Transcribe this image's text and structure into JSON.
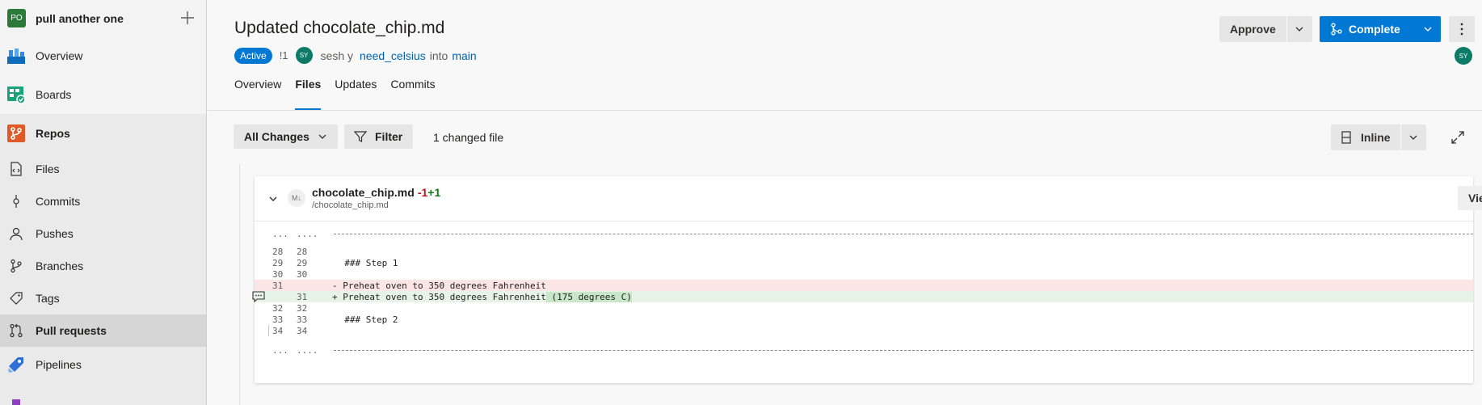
{
  "project": {
    "avatar": "PO",
    "name": "pull another one"
  },
  "nav": {
    "overview": "Overview",
    "boards": "Boards",
    "repos": "Repos",
    "files": "Files",
    "commits": "Commits",
    "pushes": "Pushes",
    "branches": "Branches",
    "tags": "Tags",
    "pull_requests": "Pull requests",
    "pipelines": "Pipelines"
  },
  "pr": {
    "title": "Updated chocolate_chip.md",
    "status": "Active",
    "id": "!1",
    "author_avatar": "SY",
    "author": "sesh y",
    "source_branch": "need_celsius",
    "into": "into",
    "target_branch": "main",
    "approve_label": "Approve",
    "complete_label": "Complete",
    "reviewer_avatar": "SY"
  },
  "tabs": [
    "Overview",
    "Files",
    "Updates",
    "Commits"
  ],
  "toolbar": {
    "all_changes": "All Changes",
    "filter": "Filter",
    "changed_files": "1 changed file",
    "view_mode": "Inline"
  },
  "file": {
    "icon": "M↓",
    "name": "chocolate_chip.md",
    "deletions": "-1",
    "additions": "+1",
    "path": "/chocolate_chip.md",
    "view_label": "View"
  },
  "diff_lines": {
    "sep_top_a": "...",
    "sep_top_b": "....",
    "l28a": "28",
    "l28b": "28",
    "c28": "",
    "l29a": "29",
    "l29b": "29",
    "c29": "  ### Step 1",
    "l30a": "30",
    "l30b": "30",
    "c30": "",
    "l31a": "31",
    "c31": "- Preheat oven to 350 degrees Fahrenheit",
    "l31b": "31",
    "c31add": "+ Preheat oven to 350 degrees Fahrenheit",
    "c31addhl": " (175 degrees C)",
    "l32a": "32",
    "l32b": "32",
    "c32": "",
    "l33a": "33",
    "l33b": "33",
    "c33": "  ### Step 2",
    "l34a": "34",
    "l34b": "34",
    "c34": "",
    "sep_bot_a": "...",
    "sep_bot_b": "...."
  },
  "colors": {
    "accent": "#0078d4",
    "deleted": "#c50f1f",
    "added": "#107c10"
  }
}
